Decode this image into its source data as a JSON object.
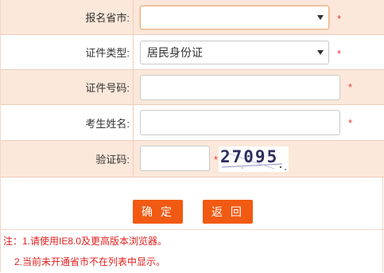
{
  "fields": {
    "province": {
      "label": "报名省市:",
      "value": "",
      "required": "*"
    },
    "id_type": {
      "label": "证件类型:",
      "value": "居民身份证",
      "required": "*"
    },
    "id_number": {
      "label": "证件号码:",
      "value": "",
      "required": "*"
    },
    "name": {
      "label": "考生姓名:",
      "value": "",
      "required": "*"
    },
    "captcha": {
      "label": "验证码:",
      "value": "",
      "required": "*",
      "image_text": "27095"
    }
  },
  "buttons": {
    "confirm": "确 定",
    "back": "返 回"
  },
  "notes": {
    "line1": "注：1.请使用IE8.0及更高版本浏览器。",
    "line2": "2.当前未开通省市不在列表中显示。"
  },
  "colors": {
    "accent": "#f15a12",
    "required": "#e53935",
    "row_shade": "#fbe8da",
    "note": "#e02020"
  }
}
